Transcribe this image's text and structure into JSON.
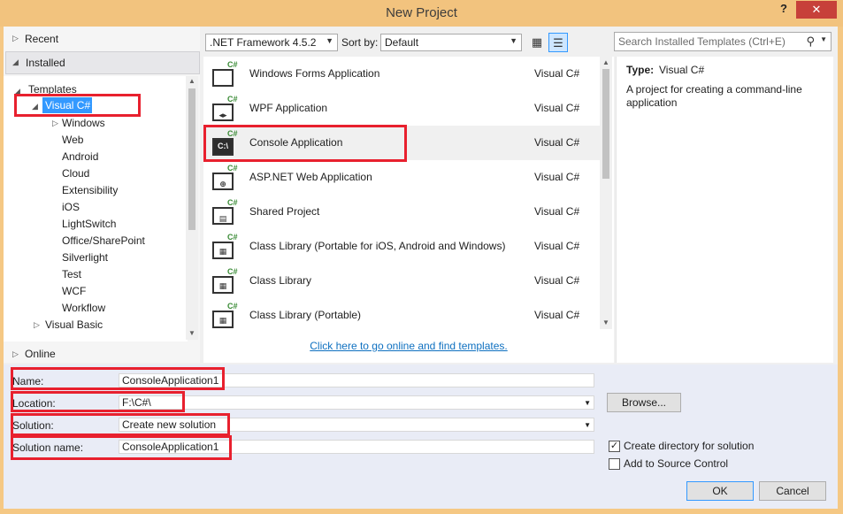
{
  "window": {
    "title": "New Project",
    "help": "?",
    "close": "✕"
  },
  "nav": {
    "recent": "Recent",
    "installed": "Installed",
    "online": "Online",
    "tree": {
      "templates": "Templates",
      "visual_csharp": "Visual C#",
      "children": [
        "Windows",
        "Web",
        "Android",
        "Cloud",
        "Extensibility",
        "iOS",
        "LightSwitch",
        "Office/SharePoint",
        "Silverlight",
        "Test",
        "WCF",
        "Workflow"
      ],
      "visual_basic": "Visual Basic"
    }
  },
  "toolbar": {
    "framework": ".NET Framework 4.5.2",
    "sort_label": "Sort by:",
    "sort_value": "Default",
    "search_placeholder": "Search Installed Templates (Ctrl+E)"
  },
  "templates": [
    {
      "name": "Windows Forms Application",
      "lang": "Visual C#",
      "icon": "windows-forms-icon"
    },
    {
      "name": "WPF Application",
      "lang": "Visual C#",
      "icon": "wpf-icon"
    },
    {
      "name": "Console Application",
      "lang": "Visual C#",
      "icon": "console-icon",
      "selected": true
    },
    {
      "name": "ASP.NET Web Application",
      "lang": "Visual C#",
      "icon": "web-icon"
    },
    {
      "name": "Shared Project",
      "lang": "Visual C#",
      "icon": "shared-project-icon"
    },
    {
      "name": "Class Library (Portable for iOS, Android and Windows)",
      "lang": "Visual C#",
      "icon": "class-library-icon"
    },
    {
      "name": "Class Library",
      "lang": "Visual C#",
      "icon": "class-library-icon"
    },
    {
      "name": "Class Library (Portable)",
      "lang": "Visual C#",
      "icon": "class-library-icon"
    }
  ],
  "online_link": "Click here to go online and find templates.",
  "description": {
    "type_label": "Type:",
    "type_value": "Visual C#",
    "text": "A project for creating a command-line application"
  },
  "form": {
    "name_label": "Name:",
    "name_value": "ConsoleApplication1",
    "location_label": "Location:",
    "location_value": "F:\\C#\\",
    "solution_label": "Solution:",
    "solution_value": "Create new solution",
    "solution_name_label": "Solution name:",
    "solution_name_value": "ConsoleApplication1",
    "browse": "Browse...",
    "create_dir": "Create directory for solution",
    "create_dir_checked": true,
    "source_control": "Add to Source Control",
    "source_control_checked": false,
    "ok": "OK",
    "cancel": "Cancel"
  },
  "colors": {
    "highlight": "#e8202e",
    "selection": "#3399ff",
    "link": "#0e70c0",
    "titlebar": "#f2c37e"
  }
}
